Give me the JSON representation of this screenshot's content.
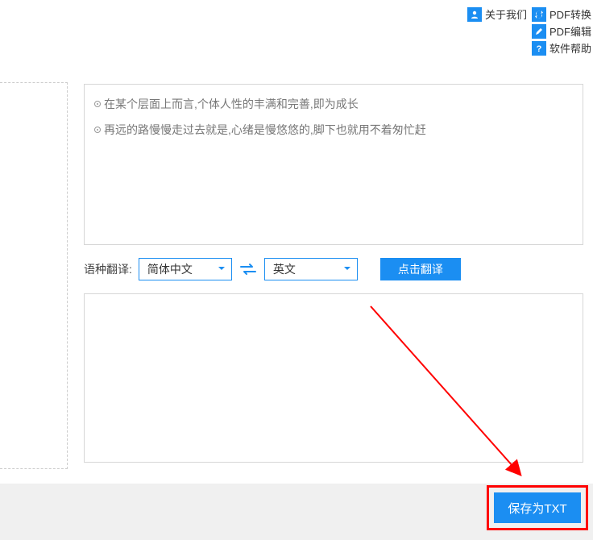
{
  "menu": {
    "about": "关于我们",
    "pdf_convert": "PDF转换",
    "pdf_edit": "PDF编辑",
    "software_help": "软件帮助"
  },
  "textbox": {
    "line1": "在某个层面上而言,个体人性的丰满和完善,即为成长",
    "line2": "再远的路慢慢走过去就是,心绪是慢悠悠的,脚下也就用不着匆忙赶"
  },
  "translate": {
    "label": "语种翻译:",
    "source": "简体中文",
    "target": "英文",
    "button": "点击翻译"
  },
  "save": {
    "button": "保存为TXT"
  },
  "colors": {
    "primary": "#1b8ef2",
    "highlight": "#ff0000"
  }
}
